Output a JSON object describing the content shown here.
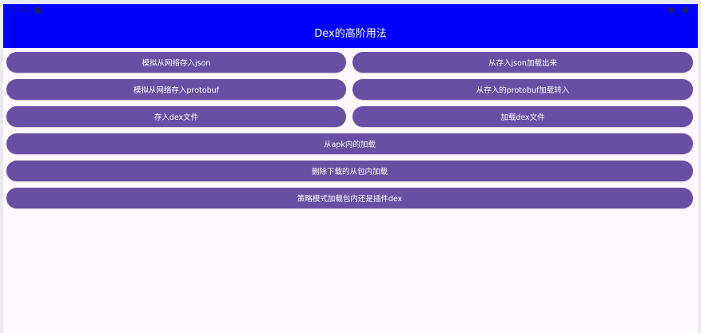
{
  "status_bar": {
    "time": "3:08"
  },
  "app_bar": {
    "title": "Dex的高阶用法"
  },
  "buttons": {
    "simulate_save_json": "模拟从网络存入json",
    "load_from_json": "从存入json加载出来",
    "simulate_save_protobuf": "模拟从网络存入protobuf",
    "load_from_protobuf": "从存入的protobuf加载转入",
    "save_dex_file": "存入dex文件",
    "load_dex_file": "加载dex文件",
    "load_from_apk": "从apk内的加载",
    "delete_downloaded_load_from_package": "删除下载的从包内加载",
    "strategy_mode_load": "策略模式加载包内还是插件dex"
  },
  "colors": {
    "app_bar": "#0000ff",
    "button": "#6750a4",
    "background": "#fdf7ff"
  }
}
